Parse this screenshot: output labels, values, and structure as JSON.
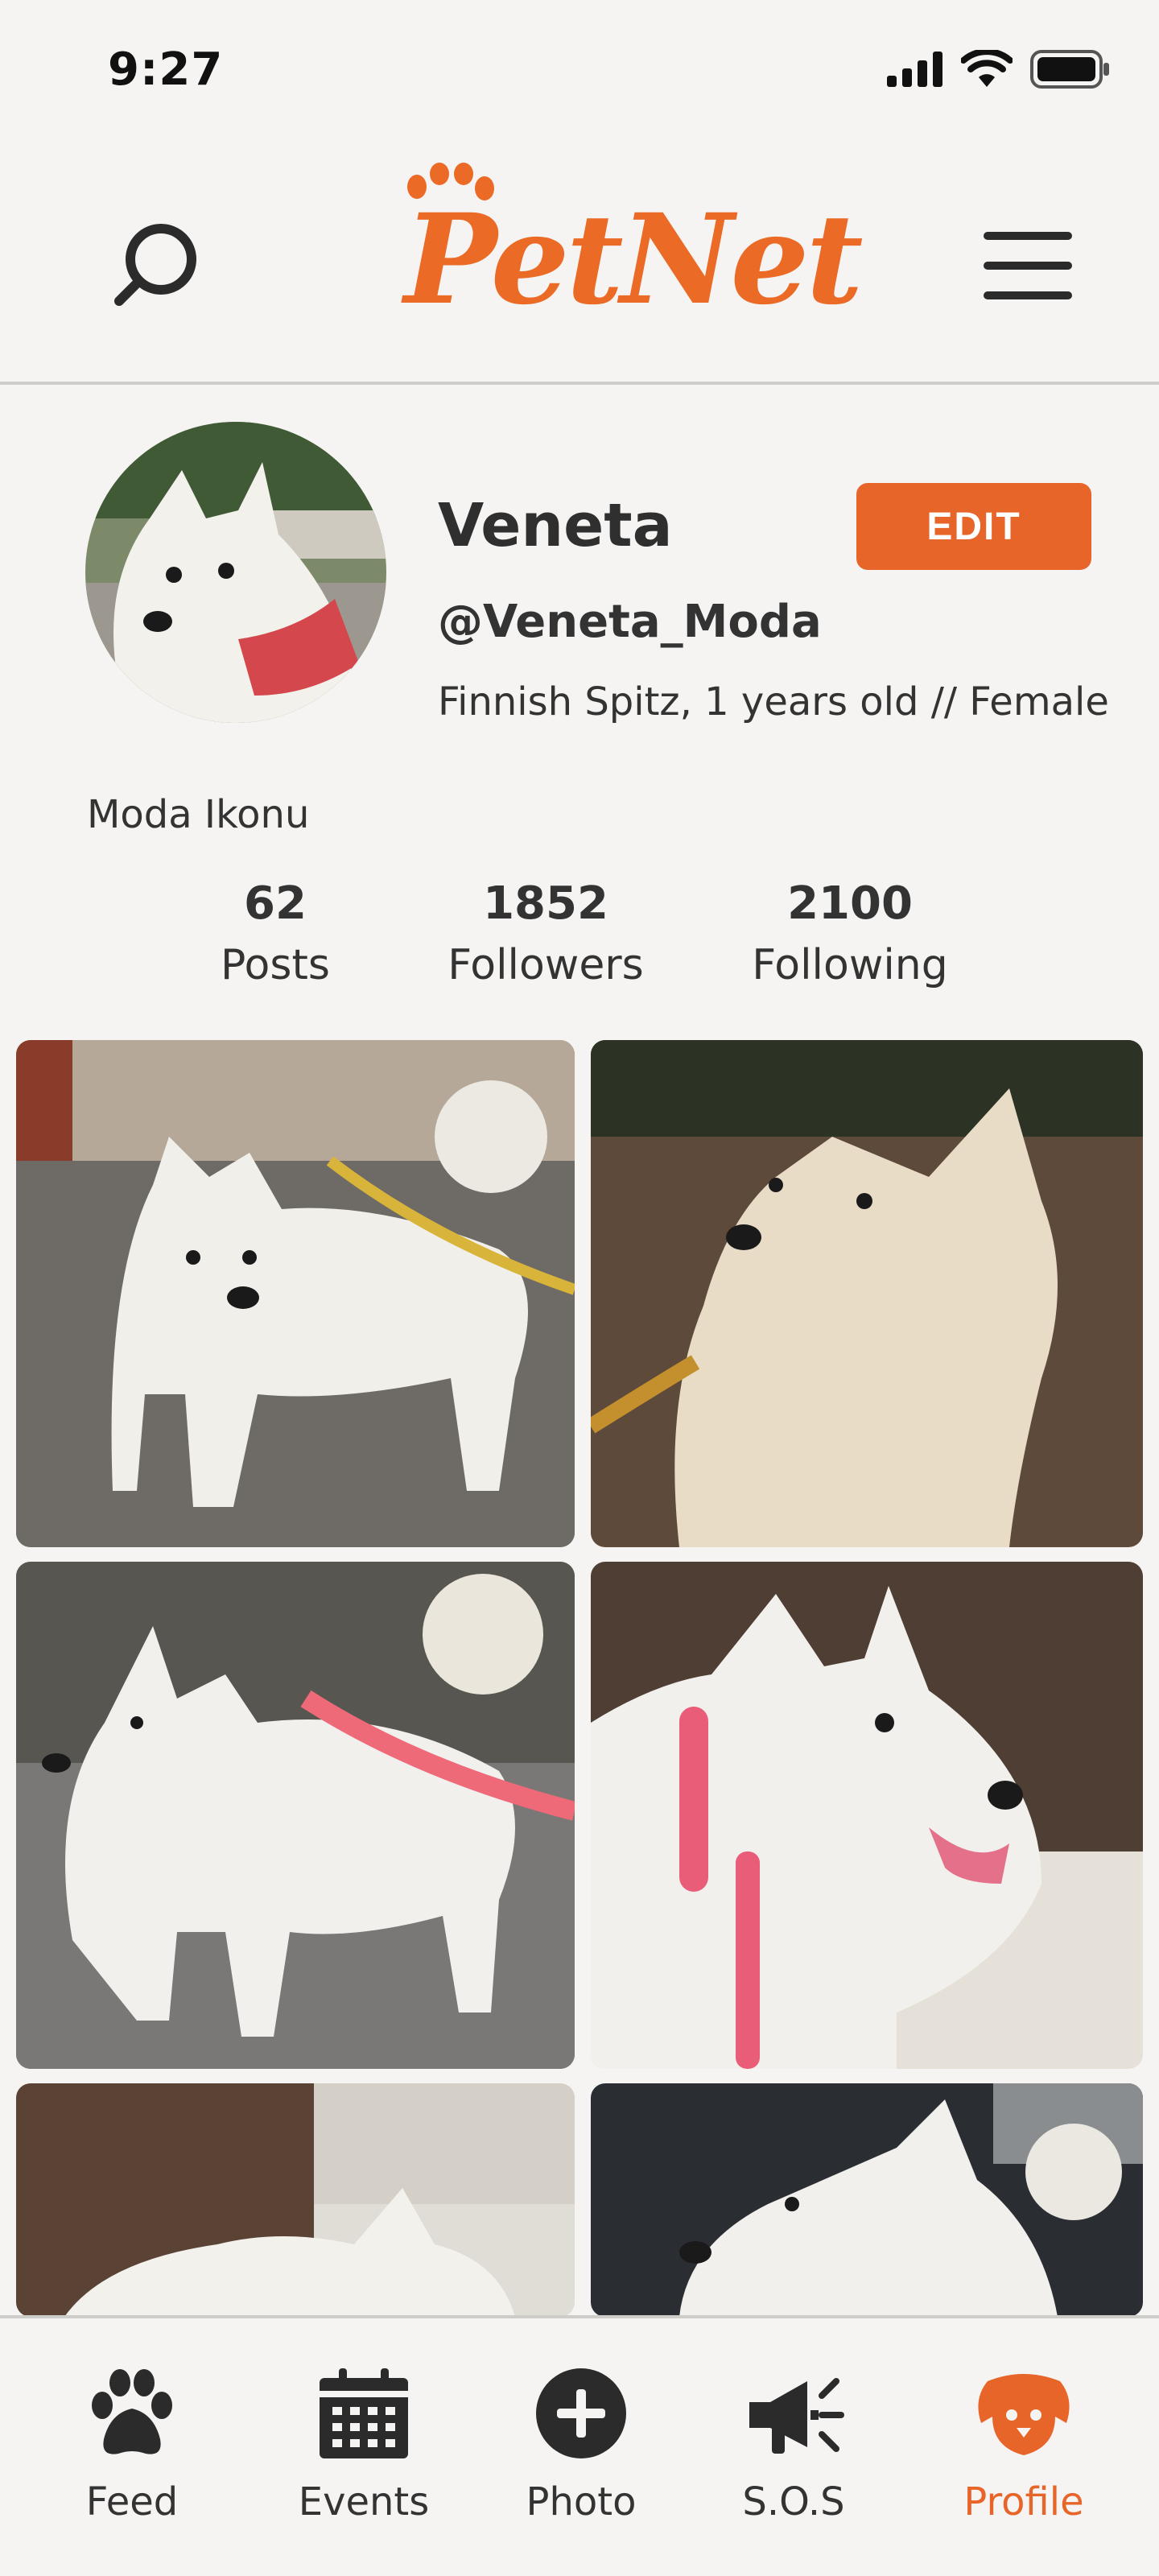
{
  "status_bar": {
    "time": "9:27"
  },
  "header": {
    "logo_text": "PetNet",
    "search_icon": "search-icon",
    "menu_icon": "hamburger-menu-icon"
  },
  "profile": {
    "name": "Veneta",
    "handle": "@Veneta_Moda",
    "description": "Finnish Spitz, 1 years old // Female",
    "bio": "Moda Ikonu",
    "edit_label": "EDIT",
    "stats": [
      {
        "value": "62",
        "label": "Posts"
      },
      {
        "value": "1852",
        "label": "Followers"
      },
      {
        "value": "2100",
        "label": "Following"
      }
    ]
  },
  "nav": {
    "items": [
      {
        "label": "Feed",
        "icon": "paw-icon"
      },
      {
        "label": "Events",
        "icon": "calendar-icon"
      },
      {
        "label": "Photo",
        "icon": "add-photo-icon"
      },
      {
        "label": "S.O.S",
        "icon": "megaphone-icon"
      },
      {
        "label": "Profile",
        "icon": "dog-face-icon"
      }
    ],
    "active": "Profile"
  },
  "colors": {
    "accent": "#e8652a",
    "background": "#f5f4f2",
    "text": "#2b2b2b"
  }
}
